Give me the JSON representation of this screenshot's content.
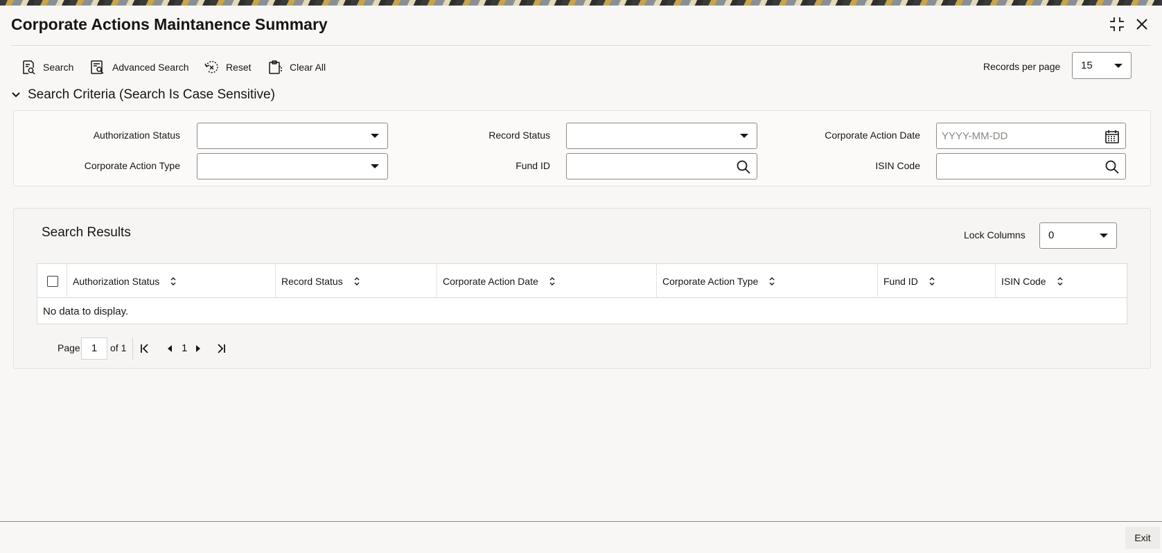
{
  "window": {
    "title": "Corporate Actions Maintanence Summary"
  },
  "toolbar": {
    "search_label": "Search",
    "advanced_search_label": "Advanced Search",
    "reset_label": "Reset",
    "clear_all_label": "Clear All",
    "records_per_page_label": "Records per page",
    "records_per_page_value": "15"
  },
  "criteria": {
    "header": "Search Criteria (Search Is Case Sensitive)",
    "authorization_status_label": "Authorization Status",
    "record_status_label": "Record Status",
    "corporate_action_date_label": "Corporate Action Date",
    "corporate_action_date_placeholder": "YYYY-MM-DD",
    "corporate_action_type_label": "Corporate Action Type",
    "fund_id_label": "Fund ID",
    "isin_code_label": "ISIN Code"
  },
  "results": {
    "title": "Search Results",
    "lock_columns_label": "Lock Columns",
    "lock_columns_value": "0",
    "columns": [
      "Authorization Status",
      "Record Status",
      "Corporate Action Date",
      "Corporate Action Type",
      "Fund ID",
      "ISIN Code"
    ],
    "empty_message": "No data to display."
  },
  "pagination": {
    "page_label": "Page",
    "current_page": "1",
    "of_label": "of 1",
    "page_number": "1"
  },
  "footer": {
    "exit_label": "Exit"
  }
}
